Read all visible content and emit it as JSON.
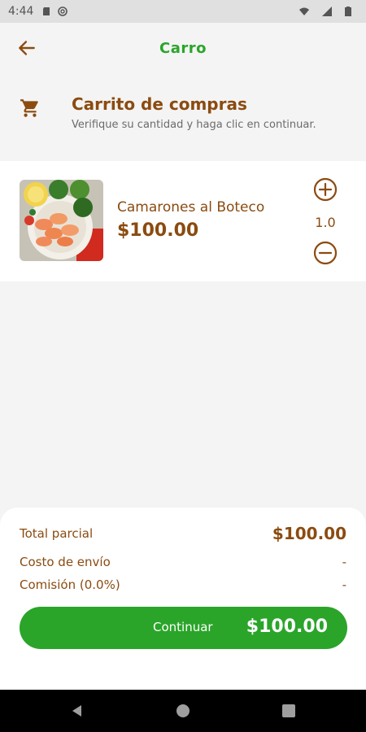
{
  "status_bar": {
    "time": "4:44"
  },
  "app_bar": {
    "title": "Carro"
  },
  "cart_header": {
    "title": "Carrito de compras",
    "subtitle": "Verifique su cantidad y haga clic en continuar."
  },
  "item": {
    "name": "Camarones al Boteco",
    "price": "$100.00",
    "quantity": "1.0"
  },
  "summary": {
    "subtotal_label": "Total parcial",
    "subtotal_value": "$100.00",
    "shipping_label": "Costo de envío",
    "shipping_value": "-",
    "commission_label": "Comisión (0.0%)",
    "commission_value": "-"
  },
  "continue_button": {
    "label": "Continuar",
    "total": "$100.00"
  },
  "colors": {
    "brand_green": "#2aa52a",
    "brand_brown": "#8b4b10"
  }
}
